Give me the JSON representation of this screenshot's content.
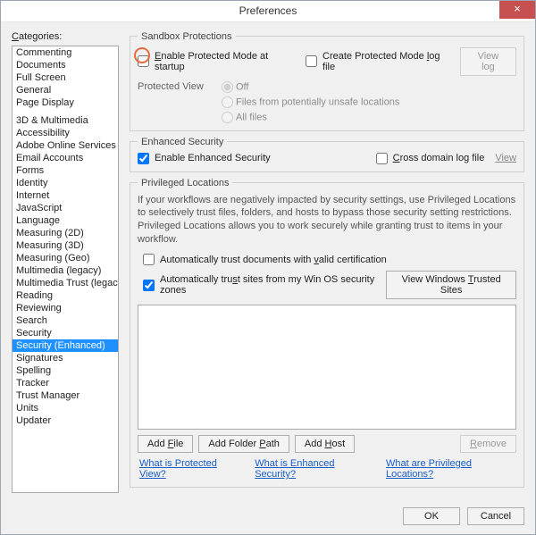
{
  "window": {
    "title": "Preferences",
    "close": "×"
  },
  "categories": {
    "label": "Categories:",
    "items_a": [
      "Commenting",
      "Documents",
      "Full Screen",
      "General",
      "Page Display"
    ],
    "items_b": [
      "3D & Multimedia",
      "Accessibility",
      "Adobe Online Services",
      "Email Accounts",
      "Forms",
      "Identity",
      "Internet",
      "JavaScript",
      "Language",
      "Measuring (2D)",
      "Measuring (3D)",
      "Measuring (Geo)",
      "Multimedia (legacy)",
      "Multimedia Trust (legacy)",
      "Reading",
      "Reviewing",
      "Search",
      "Security",
      "Security (Enhanced)",
      "Signatures",
      "Spelling",
      "Tracker",
      "Trust Manager",
      "Units",
      "Updater"
    ],
    "selected": "Security (Enhanced)"
  },
  "sandbox": {
    "legend": "Sandbox Protections",
    "enable_protected": "Enable Protected Mode at startup",
    "create_logfile": "Create Protected Mode log file",
    "view_log": "View log",
    "protected_view_label": "Protected View",
    "radios": {
      "off": "Off",
      "unsafe": "Files from potentially unsafe locations",
      "all": "All files"
    }
  },
  "enhanced": {
    "legend": "Enhanced Security",
    "enable": "Enable Enhanced Security",
    "cross_domain": "Cross domain log file",
    "view": "View"
  },
  "priv": {
    "legend": "Privileged Locations",
    "desc": "If your workflows are negatively impacted by security settings, use Privileged Locations to selectively trust files, folders, and hosts to bypass those security setting restrictions. Privileged Locations allows you to work securely while granting trust to items in your workflow.",
    "auto_trust_cert": "Automatically trust documents with valid certification",
    "auto_trust_os": "Automatically trust sites from my Win OS security zones",
    "view_trusted": "View Windows Trusted Sites",
    "add_file": "Add File",
    "add_folder": "Add Folder Path",
    "add_host": "Add Host",
    "remove": "Remove"
  },
  "help": {
    "pv": "What is Protected View?",
    "es": "What is Enhanced Security?",
    "pl": "What are Privileged Locations?"
  },
  "footer": {
    "ok": "OK",
    "cancel": "Cancel"
  }
}
